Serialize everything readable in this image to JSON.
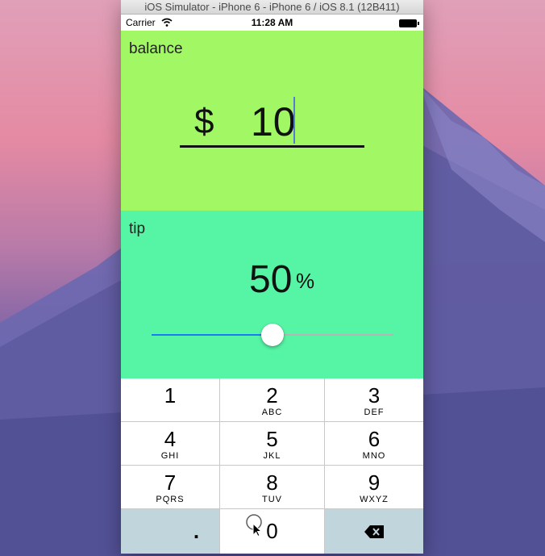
{
  "window": {
    "title": "iOS Simulator - iPhone 6 - iPhone 6 / iOS 8.1 (12B411)"
  },
  "status_bar": {
    "carrier": "Carrier",
    "time": "11:28 AM"
  },
  "balance": {
    "label": "balance",
    "currency": "$",
    "amount": "10"
  },
  "tip": {
    "label": "tip",
    "value": "50",
    "percent_sign": "%",
    "slider_fraction": 0.5
  },
  "keypad": {
    "keys": [
      {
        "digit": "1",
        "letters": ""
      },
      {
        "digit": "2",
        "letters": "ABC"
      },
      {
        "digit": "3",
        "letters": "DEF"
      },
      {
        "digit": "4",
        "letters": "GHI"
      },
      {
        "digit": "5",
        "letters": "JKL"
      },
      {
        "digit": "6",
        "letters": "MNO"
      },
      {
        "digit": "7",
        "letters": "PQRS"
      },
      {
        "digit": "8",
        "letters": "TUV"
      },
      {
        "digit": "9",
        "letters": "WXYZ"
      }
    ],
    "decimal": ".",
    "zero": "0",
    "backspace_icon": "backspace-icon"
  },
  "colors": {
    "balance_bg": "#a1f864",
    "tip_bg": "#56f5a6",
    "slider_accent": "#1a7cf5",
    "keypad_function_bg": "#c1d5dc"
  }
}
